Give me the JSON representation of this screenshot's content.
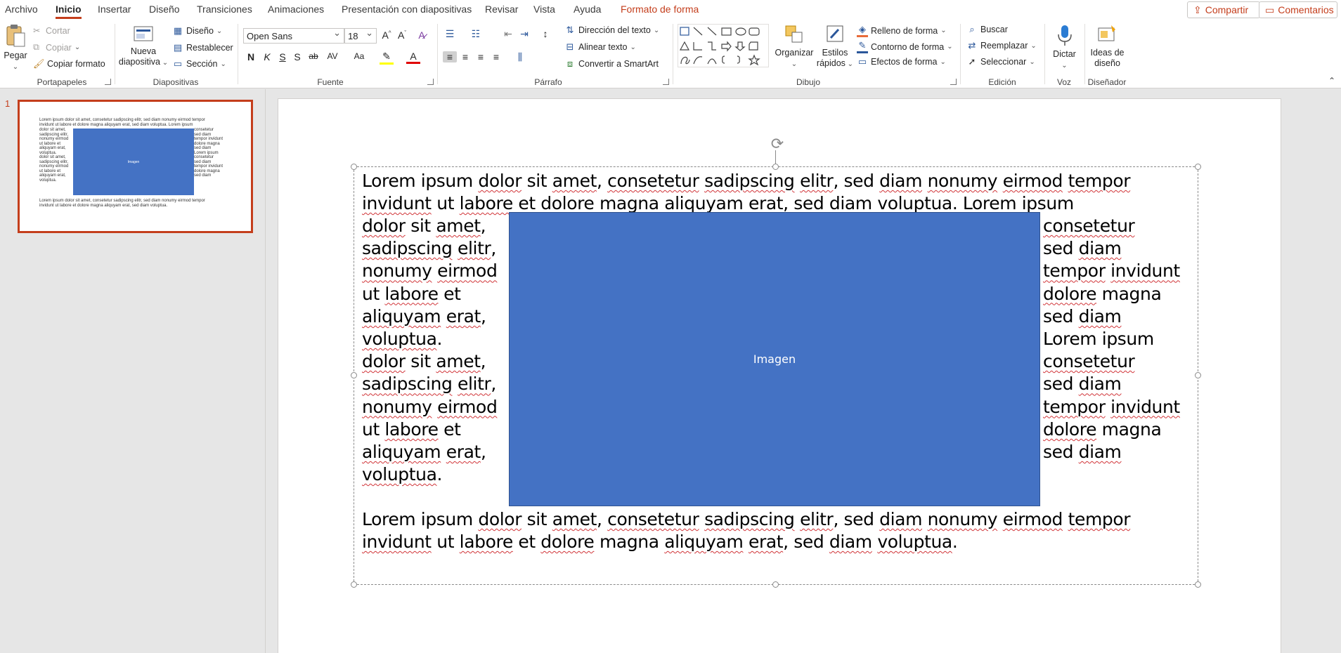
{
  "menu": {
    "tabs": [
      "Archivo",
      "Inicio",
      "Insertar",
      "Diseño",
      "Transiciones",
      "Animaciones",
      "Presentación con diapositivas",
      "Revisar",
      "Vista",
      "Ayuda",
      "Formato de forma"
    ],
    "share": "Compartir",
    "comments": "Comentarios"
  },
  "ribbon": {
    "clipboard": {
      "paste": "Pegar",
      "cut": "Cortar",
      "copy": "Copiar",
      "format_painter": "Copiar formato",
      "label": "Portapapeles"
    },
    "slides": {
      "new_line1": "Nueva",
      "new_line2": "diapositiva",
      "layout": "Diseño",
      "reset": "Restablecer",
      "section": "Sección",
      "label": "Diapositivas"
    },
    "font": {
      "name": "Open Sans",
      "size": "18",
      "bold": "N",
      "italic": "K",
      "underline": "S",
      "shadow": "S",
      "strike": "ab",
      "spacing": "AV",
      "case": "Aa",
      "label": "Fuente"
    },
    "paragraph": {
      "direction": "Dirección del texto",
      "align": "Alinear texto",
      "smartart": "Convertir a SmartArt",
      "label": "Párrafo"
    },
    "drawing": {
      "arrange": "Organizar",
      "styles_line1": "Estilos",
      "styles_line2": "rápidos",
      "fill": "Relleno de forma",
      "outline": "Contorno de forma",
      "effects": "Efectos de forma",
      "label": "Dibujo"
    },
    "editing": {
      "find": "Buscar",
      "replace": "Reemplazar",
      "select": "Seleccionar",
      "label": "Edición"
    },
    "voice": {
      "dictate": "Dictar",
      "label": "Voz"
    },
    "designer": {
      "ideas_line1": "Ideas de",
      "ideas_line2": "diseño",
      "label": "Diseñador"
    }
  },
  "thumbnail": {
    "number": "1",
    "image_label": "Imagen",
    "top_text": [
      "Lorem ipsum dolor sit amet, consetetur sadipscing elitr, sed diam nonumy eirmod tempor",
      "invidunt ut labore et dolore magna aliquyam erat, sed diam voluptua. Lorem ipsum"
    ],
    "left_text": [
      "dolor sit amet,",
      "sadipscing elitr,",
      "nonumy eirmod",
      "ut labore et",
      "aliquyam erat,",
      "voluptua.",
      "dolor sit amet,",
      "sadipscing elitr,",
      "nonumy eirmod",
      "ut labore et",
      "aliquyam erat,",
      "voluptua."
    ],
    "right_text": [
      "consetetur",
      "sed diam",
      "tempor invidunt",
      "dolore magna",
      "sed diam",
      "Lorem ipsum",
      "consetetur",
      "sed diam",
      "tempor invidunt",
      "dolore magna",
      "sed diam"
    ],
    "bottom_text": [
      "Lorem ipsum dolor sit amet, consetetur sadipscing elitr, sed diam nonumy eirmod tempor",
      "invidunt ut labore et dolore magna aliquyam erat, sed diam voluptua."
    ]
  },
  "slide": {
    "image_label": "Imagen",
    "top_lines": [
      [
        {
          "t": "Lorem ipsum "
        },
        {
          "t": "dolor",
          "u": true
        },
        {
          "t": " sit "
        },
        {
          "t": "amet",
          "u": true
        },
        {
          "t": ", "
        },
        {
          "t": "consetetur",
          "u": true
        },
        {
          "t": " "
        },
        {
          "t": "sadipscing",
          "u": true
        },
        {
          "t": " "
        },
        {
          "t": "elitr",
          "u": true
        },
        {
          "t": ", sed "
        },
        {
          "t": "diam",
          "u": true
        },
        {
          "t": " "
        },
        {
          "t": "nonumy",
          "u": true
        },
        {
          "t": " "
        },
        {
          "t": "eirmod",
          "u": true
        },
        {
          "t": " "
        },
        {
          "t": "tempor",
          "u": true
        }
      ],
      [
        {
          "t": "invidunt",
          "u": true
        },
        {
          "t": " ut "
        },
        {
          "t": "labore",
          "u": true
        },
        {
          "t": " et "
        },
        {
          "t": "dolore",
          "u": true
        },
        {
          "t": " magna "
        },
        {
          "t": "aliquyam",
          "u": true
        },
        {
          "t": " "
        },
        {
          "t": "erat",
          "u": true
        },
        {
          "t": ", sed "
        },
        {
          "t": "diam",
          "u": true
        },
        {
          "t": " "
        },
        {
          "t": "voluptua",
          "u": true
        },
        {
          "t": ". Lorem ipsum"
        }
      ]
    ],
    "left_lines": [
      [
        {
          "t": "dolor",
          "u": true
        },
        {
          "t": " sit "
        },
        {
          "t": "amet",
          "u": true
        },
        {
          "t": ","
        }
      ],
      [
        {
          "t": "sadipscing",
          "u": true
        },
        {
          "t": " "
        },
        {
          "t": "elitr",
          "u": true
        },
        {
          "t": ","
        }
      ],
      [
        {
          "t": "nonumy",
          "u": true
        },
        {
          "t": " "
        },
        {
          "t": "eirmod",
          "u": true
        }
      ],
      [
        {
          "t": "ut "
        },
        {
          "t": "labore",
          "u": true
        },
        {
          "t": " et"
        }
      ],
      [
        {
          "t": "aliquyam",
          "u": true
        },
        {
          "t": " "
        },
        {
          "t": "erat",
          "u": true
        },
        {
          "t": ","
        }
      ],
      [
        {
          "t": "voluptua",
          "u": true
        },
        {
          "t": "."
        }
      ],
      [
        {
          "t": "dolor",
          "u": true
        },
        {
          "t": " sit "
        },
        {
          "t": "amet",
          "u": true
        },
        {
          "t": ","
        }
      ],
      [
        {
          "t": "sadipscing",
          "u": true
        },
        {
          "t": " "
        },
        {
          "t": "elitr",
          "u": true
        },
        {
          "t": ","
        }
      ],
      [
        {
          "t": "nonumy",
          "u": true
        },
        {
          "t": " "
        },
        {
          "t": "eirmod",
          "u": true
        }
      ],
      [
        {
          "t": "ut "
        },
        {
          "t": "labore",
          "u": true
        },
        {
          "t": " et"
        }
      ],
      [
        {
          "t": "aliquyam",
          "u": true
        },
        {
          "t": " "
        },
        {
          "t": "erat",
          "u": true
        },
        {
          "t": ","
        }
      ],
      [
        {
          "t": "voluptua",
          "u": true
        },
        {
          "t": "."
        }
      ]
    ],
    "right_lines": [
      [
        {
          "t": "consetetur",
          "u": true
        }
      ],
      [
        {
          "t": "sed "
        },
        {
          "t": "diam",
          "u": true
        }
      ],
      [
        {
          "t": "tempor",
          "u": true
        },
        {
          "t": " "
        },
        {
          "t": "invidunt",
          "u": true
        }
      ],
      [
        {
          "t": "dolore",
          "u": true
        },
        {
          "t": " magna"
        }
      ],
      [
        {
          "t": "sed "
        },
        {
          "t": "diam",
          "u": true
        }
      ],
      [
        {
          "t": "Lorem ipsum"
        }
      ],
      [
        {
          "t": "consetetur",
          "u": true
        }
      ],
      [
        {
          "t": "sed "
        },
        {
          "t": "diam",
          "u": true
        }
      ],
      [
        {
          "t": "tempor",
          "u": true
        },
        {
          "t": " "
        },
        {
          "t": "invidunt",
          "u": true
        }
      ],
      [
        {
          "t": "dolore",
          "u": true
        },
        {
          "t": " magna"
        }
      ],
      [
        {
          "t": "sed "
        },
        {
          "t": "diam",
          "u": true
        }
      ]
    ],
    "bottom_lines": [
      [
        {
          "t": "Lorem ipsum "
        },
        {
          "t": "dolor",
          "u": true
        },
        {
          "t": " sit "
        },
        {
          "t": "amet",
          "u": true
        },
        {
          "t": ", "
        },
        {
          "t": "consetetur",
          "u": true
        },
        {
          "t": " "
        },
        {
          "t": "sadipscing",
          "u": true
        },
        {
          "t": " "
        },
        {
          "t": "elitr",
          "u": true
        },
        {
          "t": ", sed "
        },
        {
          "t": "diam",
          "u": true
        },
        {
          "t": " "
        },
        {
          "t": "nonumy",
          "u": true
        },
        {
          "t": " "
        },
        {
          "t": "eirmod",
          "u": true
        },
        {
          "t": " "
        },
        {
          "t": "tempor",
          "u": true
        }
      ],
      [
        {
          "t": "invidunt",
          "u": true
        },
        {
          "t": " ut "
        },
        {
          "t": "labore",
          "u": true
        },
        {
          "t": " et "
        },
        {
          "t": "dolore",
          "u": true
        },
        {
          "t": " magna "
        },
        {
          "t": "aliquyam",
          "u": true
        },
        {
          "t": " "
        },
        {
          "t": "erat",
          "u": true
        },
        {
          "t": ", sed "
        },
        {
          "t": "diam",
          "u": true
        },
        {
          "t": " "
        },
        {
          "t": "voluptua",
          "u": true
        },
        {
          "t": "."
        }
      ]
    ]
  },
  "colors": {
    "accent": "#c43e1c",
    "image_fill": "#4472c4",
    "spell_underline": "#d13438"
  }
}
